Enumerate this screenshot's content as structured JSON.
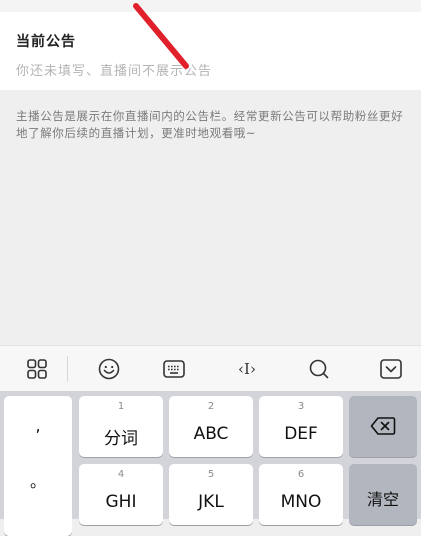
{
  "announcement": {
    "title": "当前公告",
    "placeholder": "你还未填写、直播间不展示公告",
    "description": "主播公告是展示在你直播间内的公告栏。经常更新公告可以帮助粉丝更好地了解你后续的直播计划，更准时地观看哦~"
  },
  "toolbar": {
    "icons": [
      "grid-icon",
      "emoji-icon",
      "keyboard-icon",
      "cursor-move-icon",
      "search-icon",
      "hide-keyboard-icon"
    ],
    "cursor_glyph": "‹I›"
  },
  "keyboard": {
    "punctuation": [
      ",",
      "。"
    ],
    "keys": [
      {
        "num": "1",
        "label": "分词"
      },
      {
        "num": "2",
        "label": "ABC"
      },
      {
        "num": "3",
        "label": "DEF"
      },
      {
        "num": "4",
        "label": "GHI"
      },
      {
        "num": "5",
        "label": "JKL"
      },
      {
        "num": "6",
        "label": "MNO"
      }
    ],
    "clear_label": "清空",
    "backspace_icon": "backspace-icon"
  },
  "colors": {
    "annotation_arrow": "#e0202a",
    "keyboard_bg": "#d2d4d9",
    "dark_key": "#b2b6be"
  }
}
